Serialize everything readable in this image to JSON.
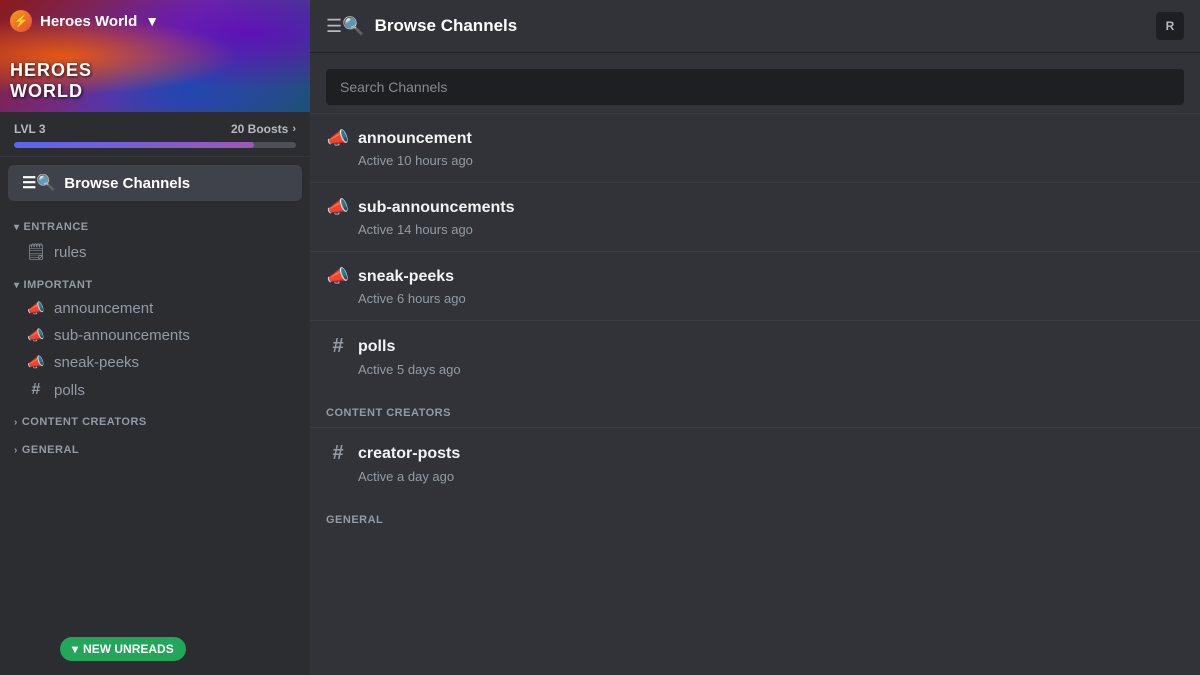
{
  "server": {
    "name": "Heroes World",
    "level": "LVL 3",
    "boosts": "20 Boosts"
  },
  "sidebar": {
    "browse_channels_label": "Browse Channels",
    "categories": [
      {
        "name": "ENTRANCE",
        "collapsed": false,
        "channels": [
          {
            "type": "rules",
            "name": "rules"
          }
        ]
      },
      {
        "name": "IMPORTANT",
        "collapsed": false,
        "channels": [
          {
            "type": "megaphone",
            "name": "announcement"
          },
          {
            "type": "megaphone",
            "name": "sub-announcements"
          },
          {
            "type": "megaphone",
            "name": "sneak-peeks"
          },
          {
            "type": "hash",
            "name": "polls"
          }
        ]
      },
      {
        "name": "CONTENT CREATORS",
        "collapsed": true,
        "channels": []
      },
      {
        "name": "GENERAL",
        "collapsed": true,
        "channels": []
      }
    ],
    "new_unreads": "NEW UNREADS"
  },
  "header": {
    "title": "Browse Channels",
    "right_button": "R"
  },
  "search": {
    "placeholder": "Search Channels"
  },
  "channels": [
    {
      "section": null,
      "items": [
        {
          "type": "megaphone",
          "name": "announcement",
          "activity": "Active 10 hours ago"
        },
        {
          "type": "megaphone",
          "name": "sub-announcements",
          "activity": "Active 14 hours ago"
        },
        {
          "type": "megaphone",
          "name": "sneak-peeks",
          "activity": "Active 6 hours ago"
        },
        {
          "type": "hash",
          "name": "polls",
          "activity": "Active 5 days ago"
        }
      ]
    },
    {
      "section": "CONTENT CREATORS",
      "items": [
        {
          "type": "hash",
          "name": "creator-posts",
          "activity": "Active a day ago"
        }
      ]
    },
    {
      "section": "GENERAL",
      "items": []
    }
  ]
}
